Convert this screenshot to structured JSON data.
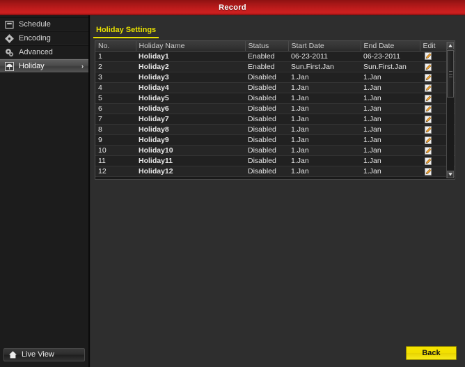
{
  "window": {
    "title": "Record",
    "title_color": "#ffffff",
    "titlebar_color": "#c01c1c"
  },
  "sidebar": {
    "items": [
      {
        "label": "Schedule",
        "icon": "schedule-icon",
        "selected": false,
        "arrow": ""
      },
      {
        "label": "Encoding",
        "icon": "gear-icon",
        "selected": false,
        "arrow": ""
      },
      {
        "label": "Advanced",
        "icon": "gears-icon",
        "selected": false,
        "arrow": ""
      },
      {
        "label": "Holiday",
        "icon": "umbrella-icon",
        "selected": true,
        "arrow": "›"
      }
    ],
    "live_view": {
      "label": "Live View",
      "icon": "home-icon"
    }
  },
  "main": {
    "tabs": [
      {
        "label": "Holiday Settings",
        "active": true
      }
    ],
    "accent_color": "#e8e000",
    "table": {
      "columns": [
        "No.",
        "Holiday Name",
        "Status",
        "Start Date",
        "End Date",
        "Edit"
      ],
      "rows": [
        {
          "no": "1",
          "name": "Holiday1",
          "status": "Enabled",
          "start": "06-23-2011",
          "end": "06-23-2011",
          "edit": "edit-icon"
        },
        {
          "no": "2",
          "name": "Holiday2",
          "status": "Enabled",
          "start": "Sun.First.Jan",
          "end": "Sun.First.Jan",
          "edit": "edit-icon"
        },
        {
          "no": "3",
          "name": "Holiday3",
          "status": "Disabled",
          "start": "1.Jan",
          "end": "1.Jan",
          "edit": "edit-icon"
        },
        {
          "no": "4",
          "name": "Holiday4",
          "status": "Disabled",
          "start": "1.Jan",
          "end": "1.Jan",
          "edit": "edit-icon"
        },
        {
          "no": "5",
          "name": "Holiday5",
          "status": "Disabled",
          "start": "1.Jan",
          "end": "1.Jan",
          "edit": "edit-icon"
        },
        {
          "no": "6",
          "name": "Holiday6",
          "status": "Disabled",
          "start": "1.Jan",
          "end": "1.Jan",
          "edit": "edit-icon"
        },
        {
          "no": "7",
          "name": "Holiday7",
          "status": "Disabled",
          "start": "1.Jan",
          "end": "1.Jan",
          "edit": "edit-icon"
        },
        {
          "no": "8",
          "name": "Holiday8",
          "status": "Disabled",
          "start": "1.Jan",
          "end": "1.Jan",
          "edit": "edit-icon"
        },
        {
          "no": "9",
          "name": "Holiday9",
          "status": "Disabled",
          "start": "1.Jan",
          "end": "1.Jan",
          "edit": "edit-icon"
        },
        {
          "no": "10",
          "name": "Holiday10",
          "status": "Disabled",
          "start": "1.Jan",
          "end": "1.Jan",
          "edit": "edit-icon"
        },
        {
          "no": "11",
          "name": "Holiday11",
          "status": "Disabled",
          "start": "1.Jan",
          "end": "1.Jan",
          "edit": "edit-icon"
        },
        {
          "no": "12",
          "name": "Holiday12",
          "status": "Disabled",
          "start": "1.Jan",
          "end": "1.Jan",
          "edit": "edit-icon"
        }
      ]
    },
    "scrollbar": {
      "up_arrow": "▲",
      "down_arrow": "▼"
    }
  },
  "footer": {
    "back_label": "Back",
    "back_color": "#f2df00"
  }
}
